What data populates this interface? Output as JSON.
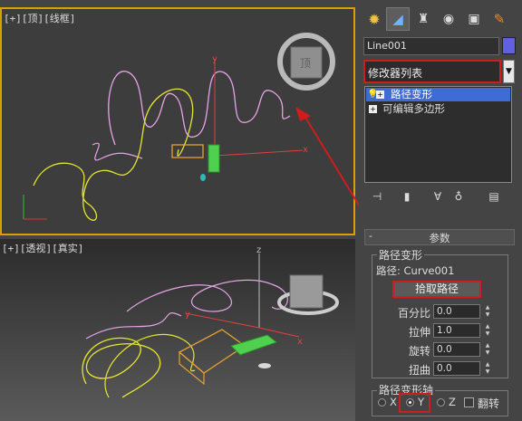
{
  "viewport_top": {
    "label": "[+][顶][线框]"
  },
  "viewport_persp": {
    "label": "[+][透视][真实]"
  },
  "viewcube": {
    "face_label": "顶"
  },
  "axis_labels": {
    "x": "x",
    "y": "y",
    "z": "z"
  },
  "panel": {
    "object_name": "Line001",
    "object_color": "#6060e0",
    "modifier_list_label": "修改器列表",
    "stack": [
      {
        "label": "路径变形",
        "selected": true
      },
      {
        "label": "可编辑多边形",
        "selected": false
      }
    ],
    "rollout_title": "参数",
    "deform_group_label": "路径变形",
    "path_prefix": "路径:",
    "path_value": "Curve001",
    "pick_path_label": "拾取路径",
    "params": [
      {
        "label": "百分比",
        "value": "0.0"
      },
      {
        "label": "拉伸",
        "value": "1.0"
      },
      {
        "label": "旋转",
        "value": "0.0"
      },
      {
        "label": "扭曲",
        "value": "0.0"
      }
    ],
    "axis_group_label": "路径变形轴",
    "axis_options": [
      "X",
      "Y",
      "Z"
    ],
    "axis_selected": "Y",
    "flip_label": "翻转"
  },
  "colors": {
    "highlight": "#d11c1c",
    "active_viewport": "#d8a100",
    "selection": "#3e6bd6"
  }
}
